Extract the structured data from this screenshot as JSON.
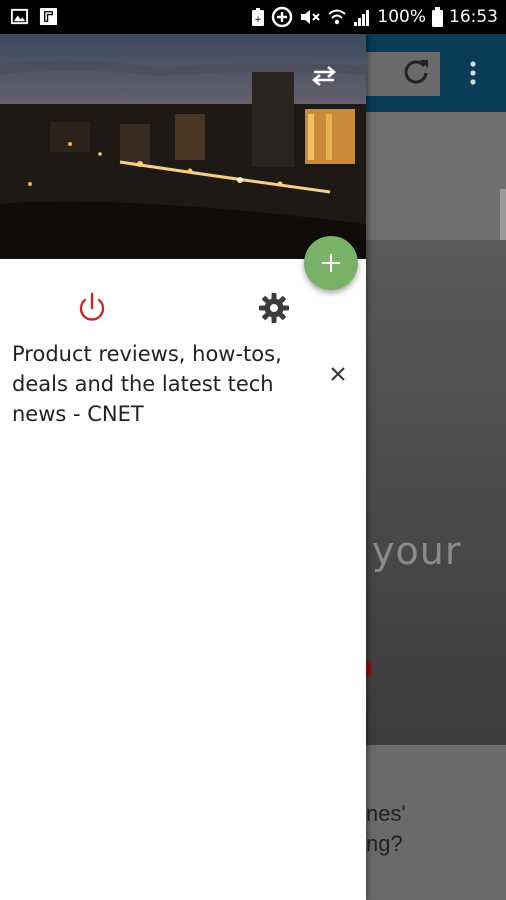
{
  "status_bar": {
    "battery_percent": "100%",
    "time": "16:53",
    "icons": [
      "image-notification-icon",
      "flipboard-notification-icon",
      "battery-saver-icon",
      "data-saver-icon",
      "mute-icon",
      "wifi-icon",
      "signal-icon",
      "battery-icon"
    ]
  },
  "drawer": {
    "header_image": "city-night-photo",
    "swap_icon": "swap-horizontal-icon",
    "fab_icon": "plus-icon",
    "power_icon": "power-icon",
    "settings_icon": "gear-icon",
    "tabs": [
      {
        "title": "Product reviews, how-tos, deals and the latest tech news - CNET",
        "close_icon": "close-icon"
      }
    ],
    "colors": {
      "fab": "#79b167",
      "power": "#c62828",
      "settings": "#3c3c3c"
    }
  },
  "background_page": {
    "hero_text_fragment": "your",
    "card_text_line1": "nes'",
    "card_text_line2": "ng?",
    "toolbar_color": "#0a3b57"
  }
}
